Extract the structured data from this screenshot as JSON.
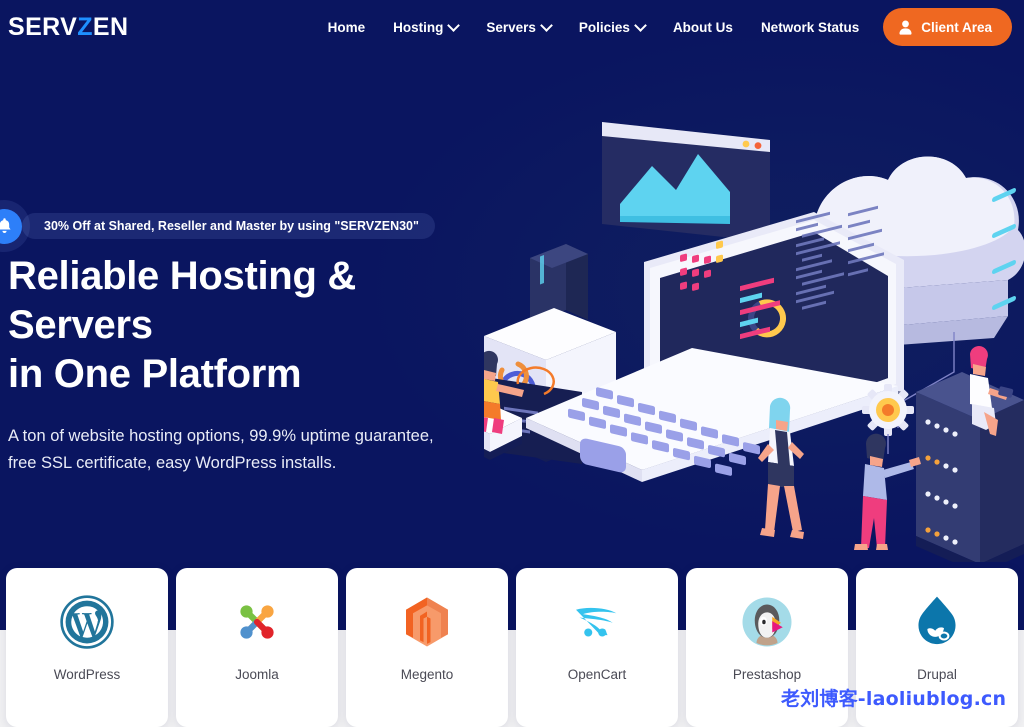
{
  "brand": {
    "name_part1": "SERV",
    "name_accent": "Z",
    "name_part2": "EN",
    "accent_color": "#1e90ff"
  },
  "nav": {
    "items": [
      {
        "label": "Home",
        "has_dropdown": false
      },
      {
        "label": "Hosting",
        "has_dropdown": true
      },
      {
        "label": "Servers",
        "has_dropdown": true
      },
      {
        "label": "Policies",
        "has_dropdown": true
      },
      {
        "label": "About Us",
        "has_dropdown": false
      },
      {
        "label": "Network Status",
        "has_dropdown": false
      }
    ],
    "cta": {
      "label": "Client Area",
      "icon": "person-icon",
      "color": "#ef6821"
    }
  },
  "announcement": {
    "icon": "bell-icon",
    "icon_color": "#2d7ff9",
    "text": "30% Off at Shared, Reseller and Master by using \"SERVZEN30\""
  },
  "hero": {
    "headline_line1": "Reliable Hosting & Servers",
    "headline_line2": "in One Platform",
    "sub_line1": "A ton of website hosting options, 99.9% uptime guarantee,",
    "sub_line2": "free SSL certificate, easy WordPress installs.",
    "background_color": "#0a1560",
    "illustration": "isometric-hosting-illustration"
  },
  "apps": [
    {
      "label": "WordPress",
      "icon": "wordpress-icon",
      "color": "#21759b"
    },
    {
      "label": "Joomla",
      "icon": "joomla-icon",
      "color": "#5091cd"
    },
    {
      "label": "Megento",
      "icon": "magento-icon",
      "color": "#f26322"
    },
    {
      "label": "OpenCart",
      "icon": "opencart-icon",
      "color": "#34c3ee"
    },
    {
      "label": "Prestashop",
      "icon": "prestashop-icon",
      "color": "#a4dbe8"
    },
    {
      "label": "Drupal",
      "icon": "drupal-icon",
      "color": "#0c76ab"
    }
  ],
  "watermark": {
    "text": "老刘博客-laoliublog.cn",
    "color": "#3d5afe"
  }
}
